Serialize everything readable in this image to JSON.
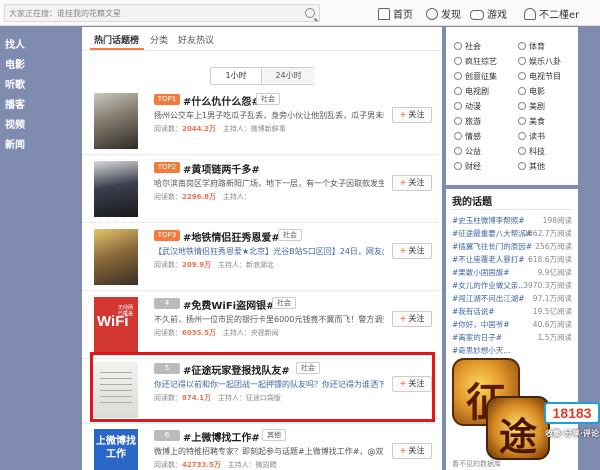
{
  "topbar": {
    "search_placeholder": "大家正在搜：谁挂我的花籍文星",
    "nav": [
      {
        "label": "首页",
        "icon": "home-icon"
      },
      {
        "label": "发现",
        "icon": "compass-icon"
      },
      {
        "label": "游戏",
        "icon": "gamepad-icon"
      },
      {
        "label": "不二槿er",
        "icon": "user-icon"
      }
    ]
  },
  "leftnav": [
    "找人",
    "电影",
    "听歌",
    "播客",
    "视频",
    "新闻"
  ],
  "tabs": [
    {
      "label": "热门话题榜",
      "active": true
    },
    {
      "label": "分类",
      "active": false
    },
    {
      "label": "好友热议",
      "active": false
    }
  ],
  "period_toggle": {
    "options": [
      "1小时",
      "24小时"
    ],
    "selected": "1小时"
  },
  "topics": [
    {
      "rank": "TOP1",
      "rank_style": "orange",
      "title": "#什么仇什么怨#",
      "category": "社会",
      "desc": "扬州公交车上1男子吃瓜子乱丢，身旁小伙让他别乱丢，瓜子男未听劝直...",
      "read_label": "阅读数",
      "reads": "2044.2万",
      "host_label": "主持人",
      "host": "微博新鲜事",
      "follow_label": "关注"
    },
    {
      "rank": "TOP2",
      "rank_style": "orange",
      "title": "#黄项链两千多#",
      "category": "",
      "desc": "哈尔滨南岗区学府路新阳广场，地下一层，有一个女子因取款发生口角，随...",
      "read_label": "阅读数",
      "reads": "2296.8万",
      "host_label": "主持人",
      "host": "",
      "follow_label": "关注"
    },
    {
      "rank": "TOP3",
      "rank_style": "orange",
      "title": "#地铁情侣狂秀恩爱#",
      "category": "社会",
      "desc": "【武汉地铁情侣狂秀恩爱★北京】光谷B站S口区回】24日，网友@曹曹鸟...",
      "read_label": "阅读数",
      "reads": "209.9万",
      "host_label": "主持人",
      "host": "新浪湖北",
      "follow_label": "关注"
    },
    {
      "rank": "4",
      "rank_style": "grey",
      "title": "#免费WiFi盗网银#",
      "category": "社会",
      "desc": "不久前，扬州一位市民的银行卡里6000元钱竟不翼而飞！警方调查发现，这可...",
      "read_label": "阅读数",
      "reads": "6035.5万",
      "host_label": "主持人",
      "host": "央视新闻",
      "follow_label": "关注"
    },
    {
      "rank": "5",
      "rank_style": "grey",
      "title": "#征途玩家登报找队友#",
      "category": "社会",
      "desc": "你还记得以前和你一起团战一起押镖的队友吗？你还记得为谁洒下了漫天...",
      "read_label": "阅读数",
      "reads": "874.1万",
      "host_label": "主持人",
      "host": "征途口袋版",
      "follow_label": "关注"
    },
    {
      "rank": "6",
      "rank_style": "grey",
      "title": "#上微博找工作#",
      "category": "其他",
      "desc": "微博上的特推招聘专家？即刻起参与话题#上微博找工作#，@双入微季特聘...",
      "read_label": "阅读数",
      "reads": "42733.5万",
      "host_label": "主持人",
      "host": "微招聘",
      "follow_label": "关注"
    }
  ],
  "thumb_texts": {
    "wifi_big": "WiFi",
    "wifi_small": "无线网已覆盖",
    "weibo_job": "上微博找工作"
  },
  "categories": [
    [
      "社会",
      "体育"
    ],
    [
      "疯狂综艺",
      "娱乐八卦"
    ],
    [
      "创意征集",
      "电视节目"
    ],
    [
      "电视剧",
      "电影"
    ],
    [
      "动漫",
      "美剧"
    ],
    [
      "旅游",
      "美食"
    ],
    [
      "情感",
      "读书"
    ],
    [
      "公益",
      "科技"
    ],
    [
      "财经",
      "其他"
    ]
  ],
  "my_topics": {
    "heading": "我的话题",
    "items": [
      {
        "title": "#史玉柱微博李帮照#",
        "reads": "198阅读"
      },
      {
        "title": "#征途最重要八大帮派#",
        "reads": "2062.7万阅读"
      },
      {
        "title": "#插翼飞往长门的原因#",
        "reads": "256万阅读"
      },
      {
        "title": "#不让座覆老人暴打#",
        "reads": "618.6万阅读"
      },
      {
        "title": "#果敢小国国旗#",
        "reads": "9.9亿阅读"
      },
      {
        "title": "#女儿的作业做父亲...",
        "reads": "3970.3万阅读"
      },
      {
        "title": "#闯江湖不问出江湖#",
        "reads": "97.1万阅读"
      },
      {
        "title": "#我有话说#",
        "reads": "19.5亿阅读"
      },
      {
        "title": "#你好，中国爷#",
        "reads": "40.6万阅读"
      },
      {
        "title": "#离家的日子#",
        "reads": "1.5万阅读"
      },
      {
        "title": "#奇思妙想小天...",
        "reads": ""
      }
    ],
    "footer": "看不见的数据库"
  },
  "game_logo": {
    "glyph1": "征",
    "glyph2": "途",
    "brand": "18183",
    "brand_sub": "收集·分享·评论"
  },
  "colors": {
    "accent": "#fa7d3c",
    "nav_bg": "#7f8baf",
    "highlight_border": "#e2151b",
    "link": "#3f66a8"
  }
}
